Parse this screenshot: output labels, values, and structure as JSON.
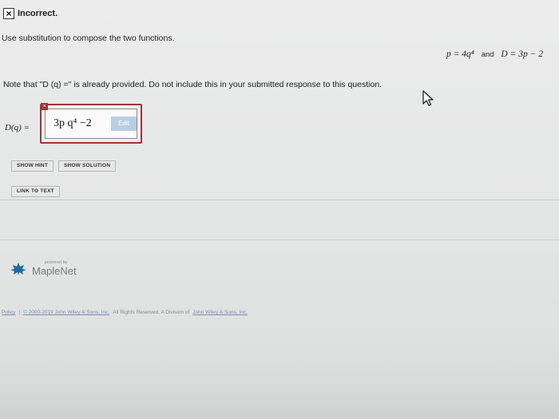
{
  "status": {
    "icon": "close-icon",
    "glyph": "×",
    "text": "Incorrect."
  },
  "instruction": "Use substitution to compose the two functions.",
  "given": {
    "p_expr": "p = 4q⁴",
    "and_word": "and",
    "d_expr": "D = 3p − 2"
  },
  "note": "Note that \"D (q) =\" is already provided. Do not include this in your submitted response to this question.",
  "answer": {
    "label": "D(q) =",
    "value": "3p q⁴ −2",
    "edit_label": "Edit",
    "error_glyph": "×"
  },
  "buttons": {
    "show_hint": "SHOW HINT",
    "show_solution": "SHOW SOLUTION",
    "link_to_text": "LINK TO TEXT"
  },
  "logo": {
    "powered": "powered by",
    "name": "MapleNet"
  },
  "footer": {
    "policy": "Policy",
    "separator": "|",
    "copyright": "© 2000-2019 John Wiley & Sons, Inc.",
    "rights": "All Rights Reserved. A Division of",
    "company": "John Wiley & Sons, Inc."
  },
  "colors": {
    "error_red": "#9a3838",
    "edit_blue": "#b9cde3"
  }
}
